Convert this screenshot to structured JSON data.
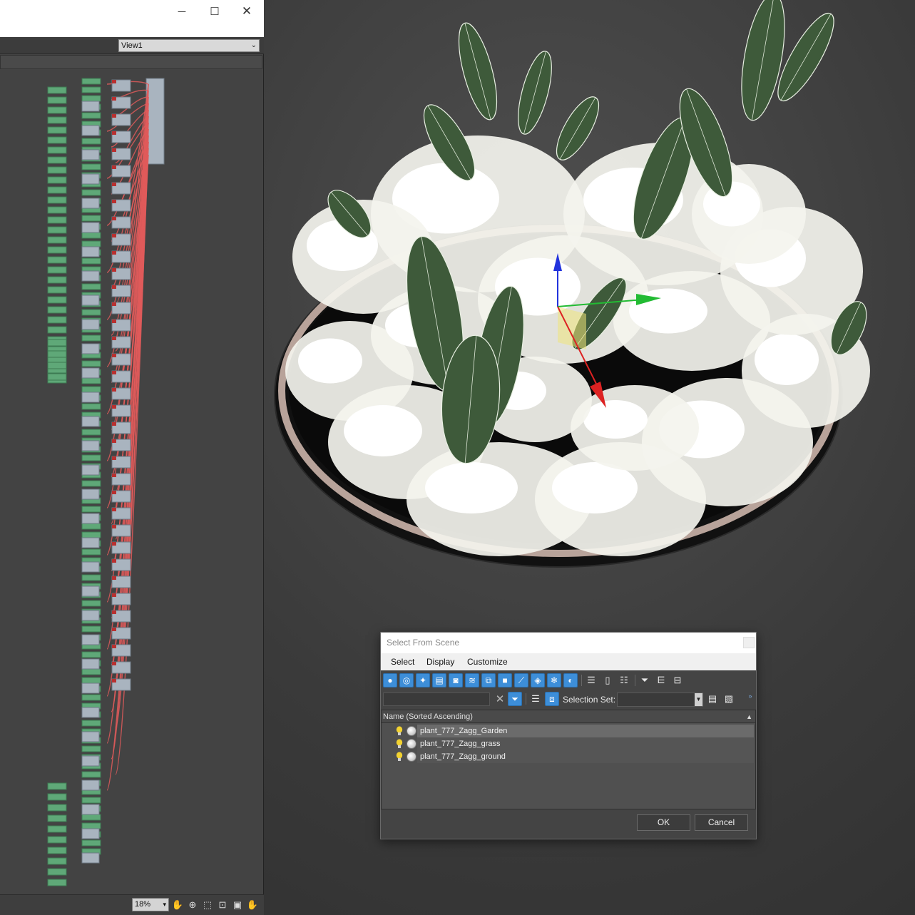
{
  "slate_editor": {
    "window_controls": {
      "minimize": "─",
      "maximize": "☐",
      "close": "✕"
    },
    "view_selector": {
      "value": "View1"
    },
    "zoom": {
      "value": "18%"
    },
    "nav_icons": [
      "pan-icon",
      "zoom-region-icon",
      "zoom-extents-icon",
      "zoom-selected-icon",
      "highlight-icon",
      "hand-icon"
    ]
  },
  "dialog": {
    "title": "Select From Scene",
    "menus": {
      "select": "Select",
      "display": "Display",
      "customize": "Customize"
    },
    "find_field": {
      "value": ""
    },
    "selection_set_label": "Selection Set:",
    "list_header": "Name (Sorted Ascending)",
    "rows": [
      {
        "name": "plant_777_Zagg_Garden",
        "selected": true
      },
      {
        "name": "plant_777_Zagg_grass",
        "selected": false
      },
      {
        "name": "plant_777_Zagg_ground",
        "selected": false
      }
    ],
    "ok_label": "OK",
    "cancel_label": "Cancel"
  },
  "colors": {
    "accent_blue": "#3d8ed8",
    "node_green": "#5fa878",
    "node_grey": "#a9b4bf",
    "wire_red": "#e05a5a",
    "gizmo_x": "#dd2222",
    "gizmo_y": "#22bb33",
    "gizmo_z": "#2233dd"
  }
}
